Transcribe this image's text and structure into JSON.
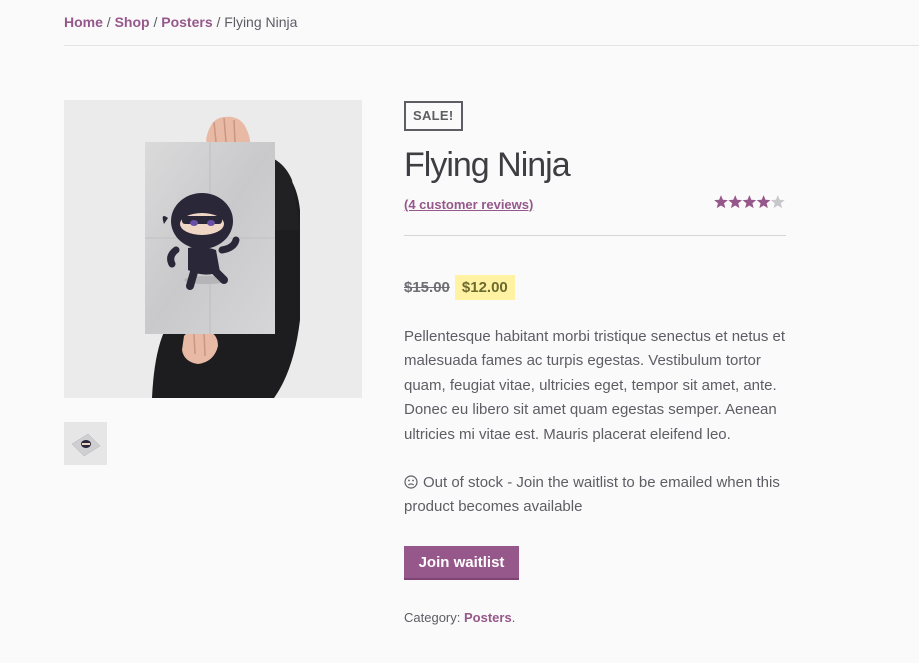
{
  "breadcrumb": {
    "items": [
      "Home",
      "Shop",
      "Posters"
    ],
    "separator": "/",
    "current": "Flying Ninja"
  },
  "product": {
    "sale_badge": "SALE!",
    "title": "Flying Ninja",
    "reviews_link": "(4 customer reviews)",
    "rating": 4,
    "rating_max": 5,
    "old_price": "$15.00",
    "new_price": "$12.00",
    "description": "Pellentesque habitant morbi tristique senectus et netus et malesuada fames ac turpis egestas. Vestibulum tortor quam, feugiat vitae, ultricies eget, tempor sit amet, ante. Donec eu libero sit amet quam egestas semper. Aenean ultricies mi vitae est. Mauris placerat eleifend leo.",
    "stock_message": "Out of stock - Join the waitlist to be emailed when this product becomes available",
    "stock_icon": "sad-face-icon",
    "waitlist_button": "Join waitlist",
    "category_label": "Category:",
    "category_value": "Posters",
    "category_suffix": "."
  },
  "colors": {
    "accent": "#96588a",
    "price_highlight": "#fff3a3",
    "text": "#5d5d64",
    "star_empty": "#c8c8cc"
  }
}
